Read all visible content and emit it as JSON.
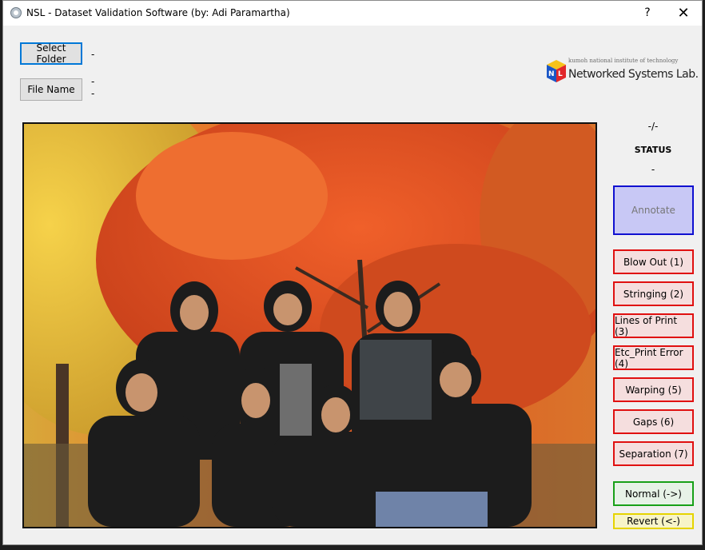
{
  "window": {
    "title": "NSL - Dataset Validation Software (by: Adi Paramartha)",
    "help_glyph": "?",
    "close_glyph": "✕"
  },
  "top": {
    "select_folder_label": "Select Folder",
    "folder_value": "-",
    "file_name_label": "File Name",
    "file_value_1": "-",
    "file_value_2": "-"
  },
  "logo": {
    "small_text": "kumoh national institute of technology",
    "name": "Networked Systems Lab."
  },
  "status": {
    "counter": "-/-",
    "heading": "STATUS",
    "value": "-"
  },
  "buttons": {
    "annotate": "Annotate",
    "defects": [
      "Blow Out (1)",
      "Stringing (2)",
      "Lines of Print (3)",
      "Etc_Print Error (4)",
      "Warping (5)",
      "Gaps (6)",
      "Separation (7)"
    ],
    "normal": "Normal (->)",
    "revert": "Revert (<-)"
  },
  "colors": {
    "annotate_border": "#1010d0",
    "defect_border": "#e01010",
    "normal_border": "#18a018",
    "revert_border": "#e6d400",
    "focus_border": "#0078d7"
  }
}
